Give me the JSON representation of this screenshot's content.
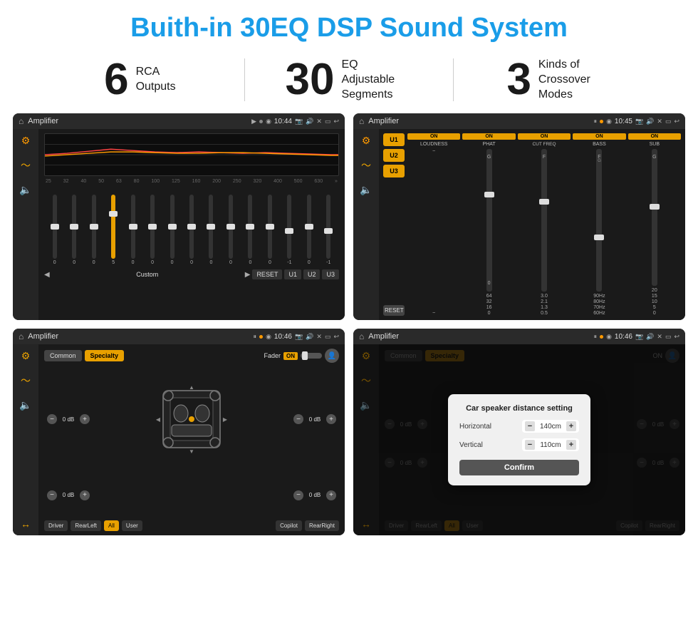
{
  "header": {
    "title": "Buith-in 30EQ DSP Sound System"
  },
  "stats": [
    {
      "number": "6",
      "text": "RCA\nOutputs"
    },
    {
      "number": "30",
      "text": "EQ Adjustable\nSegments"
    },
    {
      "number": "3",
      "text": "Kinds of\nCrossover Modes"
    }
  ],
  "screens": [
    {
      "id": "screen1",
      "status": {
        "title": "Amplifier",
        "time": "10:44"
      },
      "eq_freqs": [
        "25",
        "32",
        "40",
        "50",
        "63",
        "80",
        "100",
        "125",
        "160",
        "200",
        "250",
        "320",
        "400",
        "500",
        "630"
      ],
      "eq_values": [
        "0",
        "0",
        "0",
        "5",
        "0",
        "0",
        "0",
        "0",
        "0",
        "0",
        "0",
        "0",
        "-1",
        "0",
        "-1"
      ],
      "eq_mode": "Custom",
      "buttons": [
        "RESET",
        "U1",
        "U2",
        "U3"
      ]
    },
    {
      "id": "screen2",
      "status": {
        "title": "Amplifier",
        "time": "10:45"
      },
      "presets": [
        "U1",
        "U2",
        "U3"
      ],
      "channels": [
        {
          "toggle": "ON",
          "label": "LOUDNESS"
        },
        {
          "toggle": "ON",
          "label": "PHAT"
        },
        {
          "toggle": "ON",
          "label": "CUT FREQ"
        },
        {
          "toggle": "ON",
          "label": "BASS"
        },
        {
          "toggle": "ON",
          "label": "SUB"
        }
      ]
    },
    {
      "id": "screen3",
      "status": {
        "title": "Amplifier",
        "time": "10:46"
      },
      "tabs": [
        "Common",
        "Specialty"
      ],
      "active_tab": "Specialty",
      "fader_label": "Fader",
      "fader_toggle": "ON",
      "db_values": [
        "0 dB",
        "0 dB",
        "0 dB",
        "0 dB"
      ],
      "bottom_buttons": [
        "Driver",
        "RearLeft",
        "All",
        "User",
        "Copilot",
        "RearRight"
      ]
    },
    {
      "id": "screen4",
      "status": {
        "title": "Amplifier",
        "time": "10:46"
      },
      "tabs": [
        "Common",
        "Specialty"
      ],
      "dialog": {
        "title": "Car speaker distance setting",
        "fields": [
          {
            "label": "Horizontal",
            "value": "140cm"
          },
          {
            "label": "Vertical",
            "value": "110cm"
          }
        ],
        "confirm_label": "Confirm"
      },
      "db_values": [
        "0 dB",
        "0 dB"
      ],
      "bottom_buttons": [
        "Driver",
        "RearLeft",
        "All",
        "User",
        "Copilot",
        "RearRight"
      ]
    }
  ],
  "icons": {
    "home": "⌂",
    "location": "◉",
    "camera": "📷",
    "volume": "🔊",
    "back": "↩",
    "eq": "⚙",
    "wave": "〜",
    "speaker": "🔈",
    "user": "👤"
  }
}
